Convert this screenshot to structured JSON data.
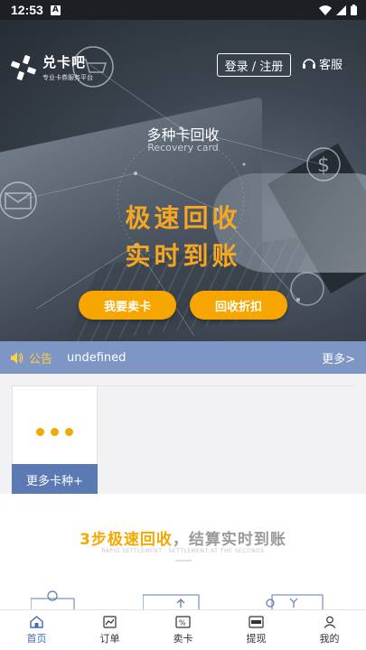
{
  "status_bar": {
    "time": "12:53",
    "notification_icon": "A"
  },
  "header": {
    "brand_name": "兑卡吧",
    "brand_sub": "专业卡券服务平台",
    "login_label": "登录 / 注册",
    "service_label": "客服"
  },
  "hero": {
    "title": "多种卡回收",
    "subtitle": "Recovery card",
    "slogan_line1": "极速回收",
    "slogan_line2": "实时到账",
    "sell_button": "我要卖卡",
    "rate_button": "回收折扣"
  },
  "notice": {
    "label": "公告",
    "text": "undefined",
    "more": "更多>"
  },
  "cards": {
    "more_label": "更多卡种+"
  },
  "steps": {
    "heading_highlight": "3步极速回收",
    "heading_rest": "，结算实时到账",
    "subheading": "RAPID SETTLEMENT · SETTLEMENT AT THE SECONDS"
  },
  "tabs": [
    {
      "label": "首页",
      "icon": "home-icon",
      "active": true
    },
    {
      "label": "订单",
      "icon": "order-icon",
      "active": false
    },
    {
      "label": "卖卡",
      "icon": "sell-card-icon",
      "active": false
    },
    {
      "label": "提现",
      "icon": "withdraw-icon",
      "active": false
    },
    {
      "label": "我的",
      "icon": "profile-icon",
      "active": false
    }
  ],
  "colors": {
    "accent": "#f5a800",
    "notice_bar": "#7d96c4",
    "tab_active": "#3f6db3",
    "more_button": "#5b7ab4"
  }
}
